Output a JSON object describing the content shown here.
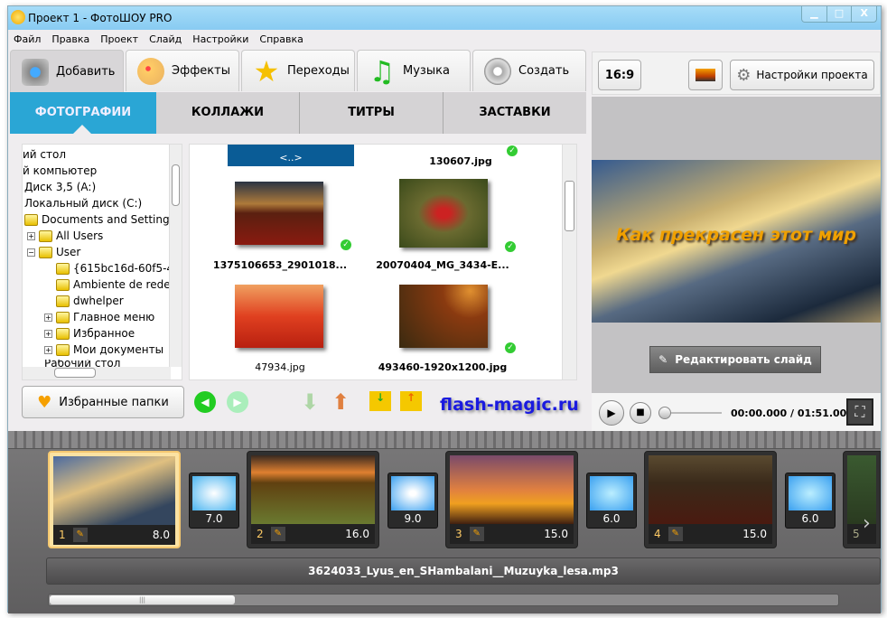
{
  "window": {
    "title": "Проект 1 - ФотоШОУ PRO",
    "controls": [
      "▁",
      "□",
      "X"
    ]
  },
  "menu": [
    "Файл",
    "Правка",
    "Проект",
    "Слайд",
    "Настройки",
    "Справка"
  ],
  "tabs": [
    {
      "label": "Добавить",
      "icon": "camera-icon"
    },
    {
      "label": "Эффекты",
      "icon": "palette-icon"
    },
    {
      "label": "Переходы",
      "icon": "star-icon"
    },
    {
      "label": "Музыка",
      "icon": "music-note-icon"
    },
    {
      "label": "Создать",
      "icon": "film-reel-icon"
    }
  ],
  "subtabs": [
    "ФОТОГРАФИИ",
    "КОЛЛАЖИ",
    "ТИТРЫ",
    "ЗАСТАВКИ"
  ],
  "tree": [
    "ий стол",
    "й компьютер",
    "Диск 3,5 (A:)",
    "Локальный диск (C:)",
    "Documents and Settings",
    "All Users",
    "User",
    "{615bc16d-60f5-4",
    "Ambiente de rede",
    "dwhelper",
    "Главное меню",
    "Избранное",
    "Мои документы",
    "Рабочий стол"
  ],
  "files": [
    "<..>",
    "130607.jpg",
    "1375106653_2901018...",
    "20070404_MG_3434-E...",
    "47934.jpg",
    "493460-1920x1200.jpg"
  ],
  "fav_button": "Избранные папки",
  "brand": "flash-magic.ru",
  "right": {
    "aspect": "16:9",
    "settings": "Настройки проекта",
    "preview_title": "Как  прекрасен этот мир",
    "edit_slide": "Редактировать слайд",
    "time": "00:00.000 / 01:51.000"
  },
  "slides": [
    {
      "n": "1",
      "d": "8.0"
    },
    {
      "n": "2",
      "d": "16.0"
    },
    {
      "n": "3",
      "d": "15.0"
    },
    {
      "n": "4",
      "d": "15.0"
    },
    {
      "n": "5",
      "d": ""
    }
  ],
  "transitions": [
    "7.0",
    "9.0",
    "6.0",
    "6.0"
  ],
  "audio_track": "3624033_Lyus_en_SHambalani__Muzuyka_lesa.mp3"
}
